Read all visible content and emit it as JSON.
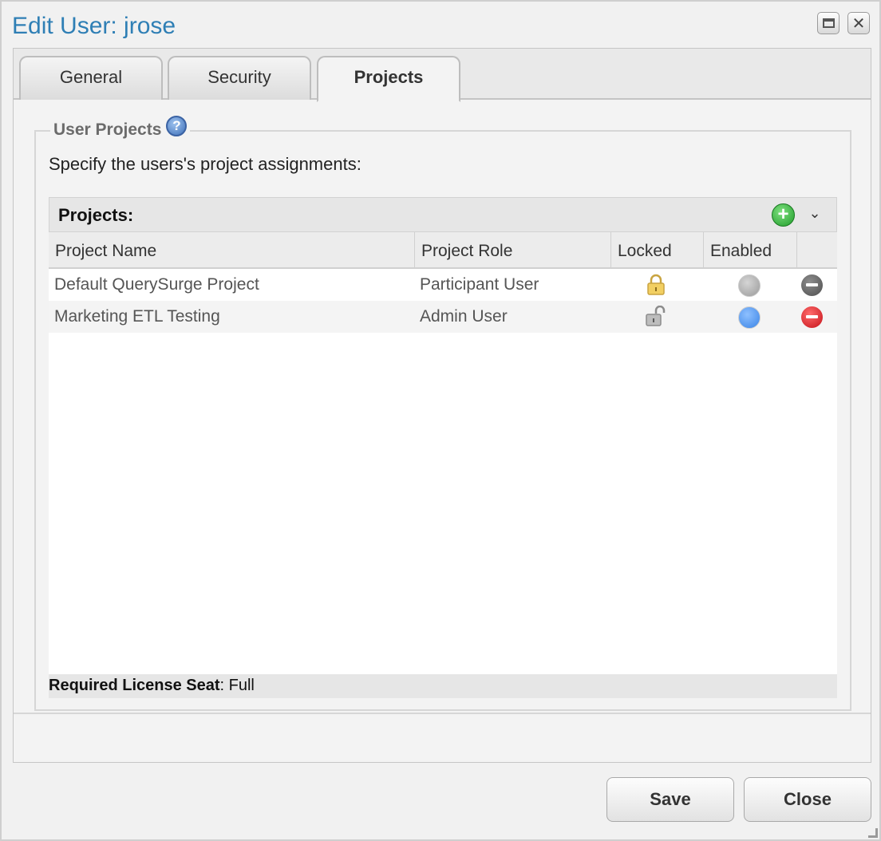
{
  "window": {
    "title": "Edit User: jrose"
  },
  "tabs": [
    {
      "label": "General"
    },
    {
      "label": "Security"
    },
    {
      "label": "Projects",
      "active": true
    }
  ],
  "section": {
    "legend": "User Projects",
    "help_icon": "?",
    "instructions": "Specify the users's project assignments:"
  },
  "grid": {
    "title": "Projects:",
    "add_icon": "+",
    "chevron": "⌄",
    "columns": [
      "Project Name",
      "Project Role",
      "Locked",
      "Enabled",
      ""
    ],
    "rows": [
      {
        "name": "Default QuerySurge Project",
        "role": "Participant User",
        "locked": true,
        "enabled": false
      },
      {
        "name": "Marketing ETL Testing",
        "role": "Admin User",
        "locked": false,
        "enabled": true
      }
    ],
    "footer_label": "Required License Seat",
    "footer_value": ": Full"
  },
  "buttons": {
    "save": "Save",
    "close": "Close"
  },
  "colors": {
    "title": "#2f7fb5",
    "enabled_on": "#3a84e6",
    "enabled_off": "#9a9a9a",
    "remove_active": "#c5121a",
    "add": "#1f9c2a"
  }
}
